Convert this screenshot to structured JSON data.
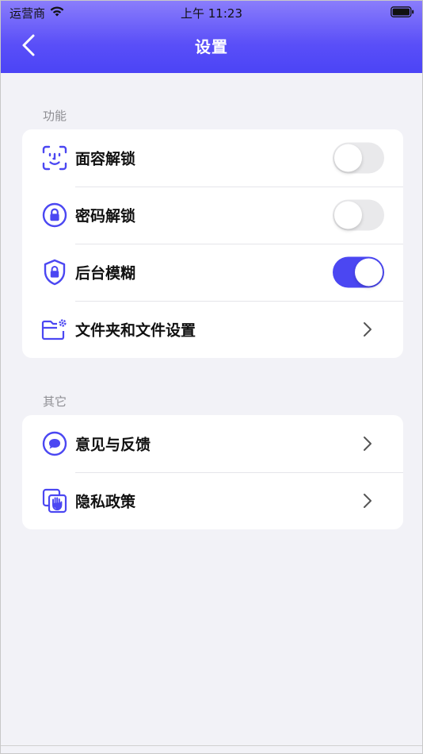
{
  "status_bar": {
    "carrier": "运营商",
    "time": "上午 11:23"
  },
  "nav": {
    "title": "设置"
  },
  "sections": [
    {
      "label": "功能",
      "rows": [
        {
          "icon": "face-id-icon",
          "label": "面容解锁",
          "control": "toggle",
          "on": false
        },
        {
          "icon": "lock-circle-icon",
          "label": "密码解锁",
          "control": "toggle",
          "on": false
        },
        {
          "icon": "shield-lock-icon",
          "label": "后台模糊",
          "control": "toggle",
          "on": true
        },
        {
          "icon": "folder-settings-icon",
          "label": "文件夹和文件设置",
          "control": "chevron"
        }
      ]
    },
    {
      "label": "其它",
      "rows": [
        {
          "icon": "chat-bubble-icon",
          "label": "意见与反馈",
          "control": "chevron"
        },
        {
          "icon": "privacy-hand-icon",
          "label": "隐私政策",
          "control": "chevron"
        }
      ]
    }
  ],
  "colors": {
    "accent": "#4b47f2",
    "header_top": "#8a7dfb",
    "header_bottom": "#4b44f6",
    "background": "#f2f2f7"
  }
}
